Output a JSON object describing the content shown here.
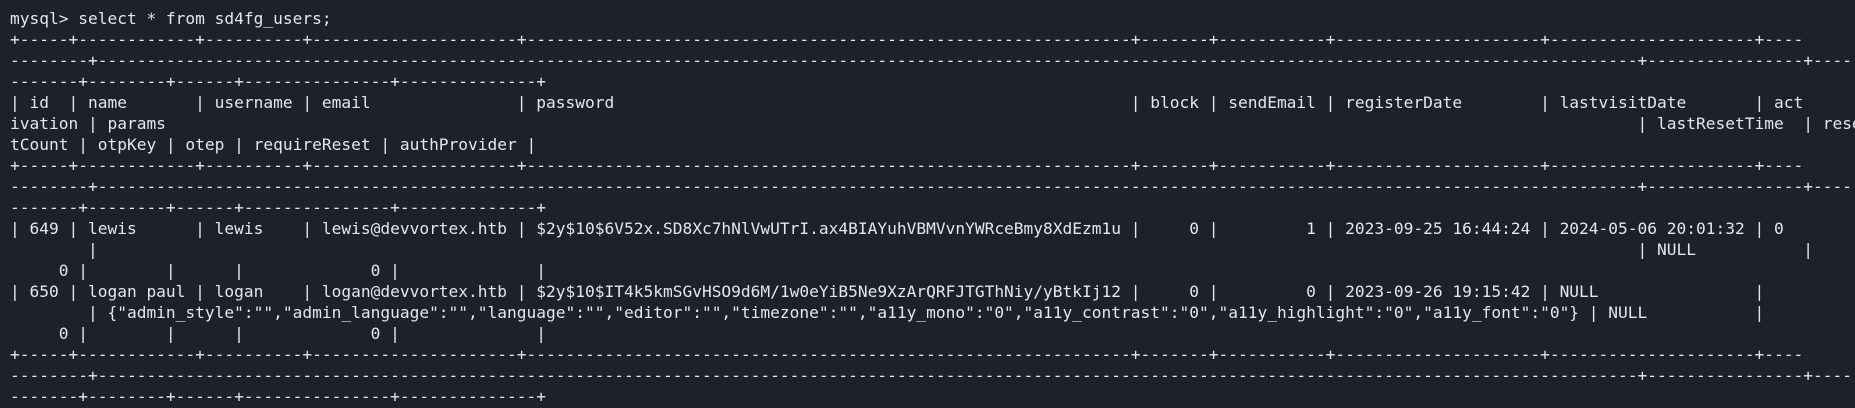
{
  "terminal": {
    "lines": [
      "mysql> select * from sd4fg_users;",
      "+-----+------------+----------+---------------------+--------------------------------------------------------------+-------+-----------+---------------------+---------------------+----",
      "--------+--------------------------------------------------------------------------------------------------------------------------------------------------------------+----------------+----",
      "-------+--------+------+---------------+--------------+",
      "| id  | name       | username | email               | password                                                     | block | sendEmail | registerDate        | lastvisitDate       | act",
      "ivation | params                                                                                                                                                       | lastResetTime  | rese",
      "tCount | otpKey | otep | requireReset | authProvider |",
      "+-----+------------+----------+---------------------+--------------------------------------------------------------+-------+-----------+---------------------+---------------------+----",
      "--------+--------------------------------------------------------------------------------------------------------------------------------------------------------------+----------------+----",
      "-------+--------+------+---------------+--------------+",
      "| 649 | lewis      | lewis    | lewis@devvortex.htb | $2y$10$6V52x.SD8Xc7hNlVwUTrI.ax4BIAYuhVBMVvnYWRceBmy8XdEzm1u |     0 |         1 | 2023-09-25 16:44:24 | 2024-05-06 20:01:32 | 0",
      "        |                                                                                                                                                              | NULL           |",
      "     0 |        |      |             0 |              |",
      "| 650 | logan paul | logan    | logan@devvortex.htb | $2y$10$IT4k5kmSGvHSO9d6M/1w0eYiB5Ne9XzArQRFJTGThNiy/yBtkIj12 |     0 |         0 | 2023-09-26 19:15:42 | NULL                |",
      "        | {\"admin_style\":\"\",\"admin_language\":\"\",\"language\":\"\",\"editor\":\"\",\"timezone\":\"\",\"a11y_mono\":\"0\",\"a11y_contrast\":\"0\",\"a11y_highlight\":\"0\",\"a11y_font\":\"0\"} | NULL           |",
      "     0 |        |      |             0 |              |",
      "+-----+------------+----------+---------------------+--------------------------------------------------------------+-------+-----------+---------------------+---------------------+----",
      "--------+--------------------------------------------------------------------------------------------------------------------------------------------------------------+----------------+----",
      "-------+--------+------+---------------+--------------+"
    ]
  },
  "colors": {
    "background": "#1d212c",
    "foreground": "#e4e6ea"
  }
}
